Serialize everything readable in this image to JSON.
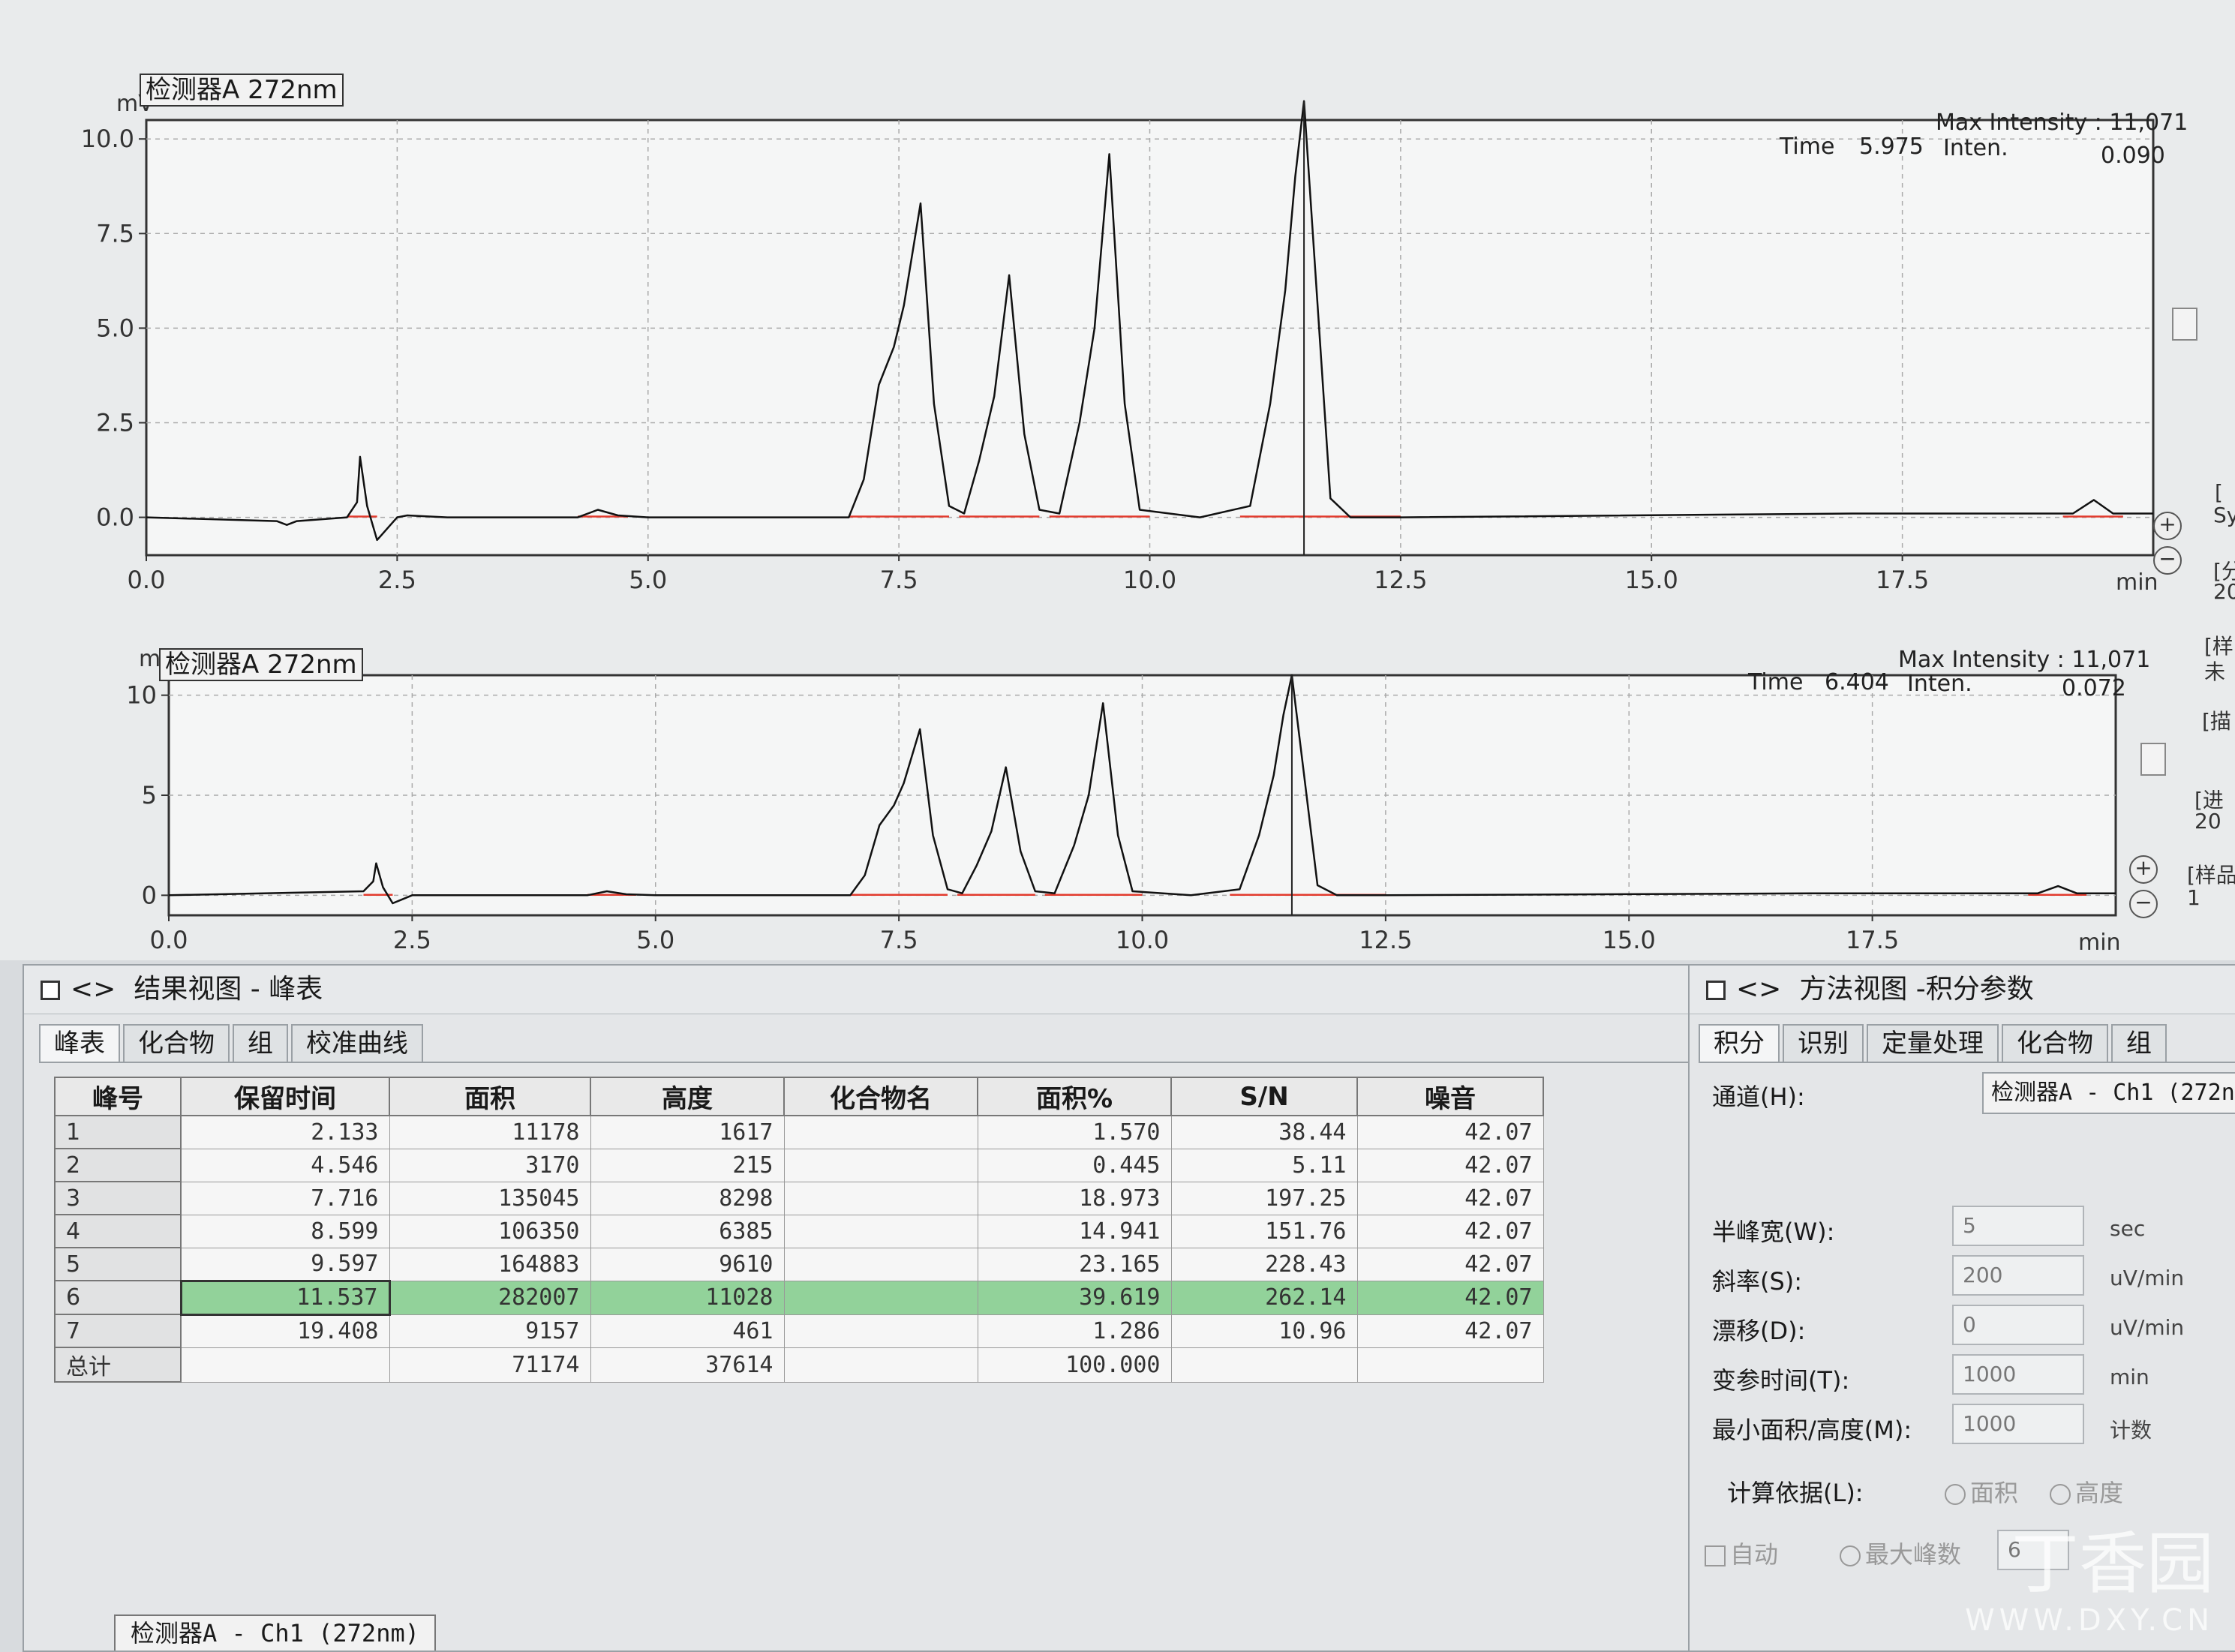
{
  "chart_data": [
    {
      "type": "line",
      "legend": "检测器A 272nm",
      "ylabel": "mV",
      "xlabel": "min",
      "xlim": [
        0,
        20
      ],
      "ylim": [
        -1,
        10.5
      ],
      "xticks": [
        "0.0",
        "2.5",
        "5.0",
        "7.5",
        "10.0",
        "12.5",
        "15.0",
        "17.5"
      ],
      "yticks": [
        "0.0",
        "2.5",
        "5.0",
        "7.5",
        "10.0"
      ],
      "info": {
        "max_intensity_label": "Max Intensity : 11,071",
        "time_label": "Time",
        "time_value": "5.975",
        "inten_label": "Inten.",
        "inten_value": "0.090"
      },
      "x": [
        0,
        1.3,
        1.4,
        1.5,
        2.0,
        2.1,
        2.13,
        2.2,
        2.3,
        2.4,
        2.5,
        2.6,
        3.0,
        4.3,
        4.5,
        4.7,
        5.0,
        7.0,
        7.15,
        7.3,
        7.45,
        7.55,
        7.716,
        7.85,
        8.0,
        8.15,
        8.3,
        8.45,
        8.599,
        8.75,
        8.9,
        9.1,
        9.3,
        9.45,
        9.597,
        9.75,
        9.9,
        10.5,
        11.0,
        11.2,
        11.35,
        11.45,
        11.537,
        11.65,
        11.8,
        12.0,
        12.5,
        17.0,
        19.2,
        19.408,
        19.6,
        20.0
      ],
      "y": [
        0,
        -0.1,
        -0.2,
        -0.1,
        0,
        0.4,
        1.6,
        0.3,
        -0.6,
        -0.3,
        0,
        0.05,
        0,
        0,
        0.2,
        0.05,
        0,
        0,
        1.0,
        3.5,
        4.5,
        5.6,
        8.3,
        3.0,
        0.3,
        0.1,
        1.5,
        3.2,
        6.4,
        2.2,
        0.2,
        0.1,
        2.5,
        5.0,
        9.6,
        3.0,
        0.2,
        0,
        0.3,
        3.0,
        6.0,
        9.0,
        11.0,
        6.5,
        0.5,
        0,
        0,
        0.1,
        0.1,
        0.46,
        0.1,
        0.1
      ]
    },
    {
      "type": "line",
      "legend": "检测器A 272nm",
      "ylabel": "mV",
      "xlabel": "min",
      "xlim": [
        0,
        20
      ],
      "ylim": [
        -1,
        11
      ],
      "xticks": [
        "0.0",
        "2.5",
        "5.0",
        "7.5",
        "10.0",
        "12.5",
        "15.0",
        "17.5"
      ],
      "yticks": [
        "0",
        "5",
        "10"
      ],
      "info": {
        "max_intensity_label": "Max Intensity : 11,071",
        "time_label": "Time",
        "time_value": "6.404",
        "inten_label": "Inten.",
        "inten_value": "0.072"
      },
      "x": [
        0,
        2.0,
        2.1,
        2.13,
        2.2,
        2.3,
        2.4,
        2.5,
        3.0,
        4.3,
        4.5,
        4.7,
        5.0,
        7.0,
        7.15,
        7.3,
        7.45,
        7.55,
        7.716,
        7.85,
        8.0,
        8.15,
        8.3,
        8.45,
        8.599,
        8.75,
        8.9,
        9.1,
        9.3,
        9.45,
        9.597,
        9.75,
        9.9,
        10.5,
        11.0,
        11.2,
        11.35,
        11.45,
        11.537,
        11.65,
        11.8,
        12.0,
        12.5,
        17.0,
        19.2,
        19.408,
        19.6,
        20.0
      ],
      "y": [
        0,
        0.2,
        0.7,
        1.6,
        0.4,
        -0.4,
        -0.2,
        0,
        0,
        0,
        0.2,
        0.05,
        0,
        0,
        1.0,
        3.5,
        4.5,
        5.6,
        8.3,
        3.0,
        0.3,
        0.1,
        1.5,
        3.2,
        6.4,
        2.2,
        0.2,
        0.1,
        2.5,
        5.0,
        9.6,
        3.0,
        0.2,
        0,
        0.3,
        3.0,
        6.0,
        9.0,
        11.0,
        6.5,
        0.5,
        0,
        0,
        0.1,
        0.1,
        0.46,
        0.1,
        0.1
      ]
    }
  ],
  "results_view": {
    "title": "结果视图 -  峰表",
    "tabs": [
      "峰表",
      "化合物",
      "组",
      "校准曲线"
    ],
    "columns": [
      "峰号",
      "保留时间",
      "面积",
      "高度",
      "化合物名",
      "面积%",
      "S/N",
      "噪音"
    ],
    "rows": [
      [
        "1",
        "2.133",
        "11178",
        "1617",
        "",
        "1.570",
        "38.44",
        "42.07"
      ],
      [
        "2",
        "4.546",
        "3170",
        "215",
        "",
        "0.445",
        "5.11",
        "42.07"
      ],
      [
        "3",
        "7.716",
        "135045",
        "8298",
        "",
        "18.973",
        "197.25",
        "42.07"
      ],
      [
        "4",
        "8.599",
        "106350",
        "6385",
        "",
        "14.941",
        "151.76",
        "42.07"
      ],
      [
        "5",
        "9.597",
        "164883",
        "9610",
        "",
        "23.165",
        "228.43",
        "42.07"
      ],
      [
        "6",
        "11.537",
        "282007",
        "11028",
        "",
        "39.619",
        "262.14",
        "42.07"
      ],
      [
        "7",
        "19.408",
        "9157",
        "461",
        "",
        "1.286",
        "10.96",
        "42.07"
      ]
    ],
    "total_row": [
      "总计",
      "",
      "71174",
      "37614",
      "",
      "100.000",
      "",
      ""
    ],
    "bottom_tab": "检测器A - Ch1 (272nm)"
  },
  "method_view": {
    "title": "方法视图 -积分参数",
    "tabs": [
      "积分",
      "识别",
      "定量处理",
      "化合物",
      "组"
    ],
    "channel_label": "通道(H):",
    "channel_value": "检测器A - Ch1 (272nm)",
    "params": [
      {
        "label": "半峰宽(W):",
        "value": "5",
        "unit": "sec"
      },
      {
        "label": "斜率(S):",
        "value": "200",
        "unit": "uV/min"
      },
      {
        "label": "漂移(D):",
        "value": "0",
        "unit": "uV/min"
      },
      {
        "label": "变参时间(T):",
        "value": "1000",
        "unit": "min"
      },
      {
        "label": "最小面积/高度(M):",
        "value": "1000",
        "unit": "计数"
      }
    ],
    "basis_label": "计算依据(L):",
    "basis_area": "面积",
    "basis_height": "高度",
    "auto_label": "自动",
    "max_peaks_label": "最大峰数",
    "max_peaks_value": "6"
  },
  "side_fragments": [
    "[",
    "Sy",
    "[分",
    "20",
    "[样",
    "未",
    "[描",
    "[进",
    "20",
    "[样品",
    "1"
  ],
  "watermark": {
    "brand": "丁香园",
    "url": "WWW.DXY.CN"
  }
}
